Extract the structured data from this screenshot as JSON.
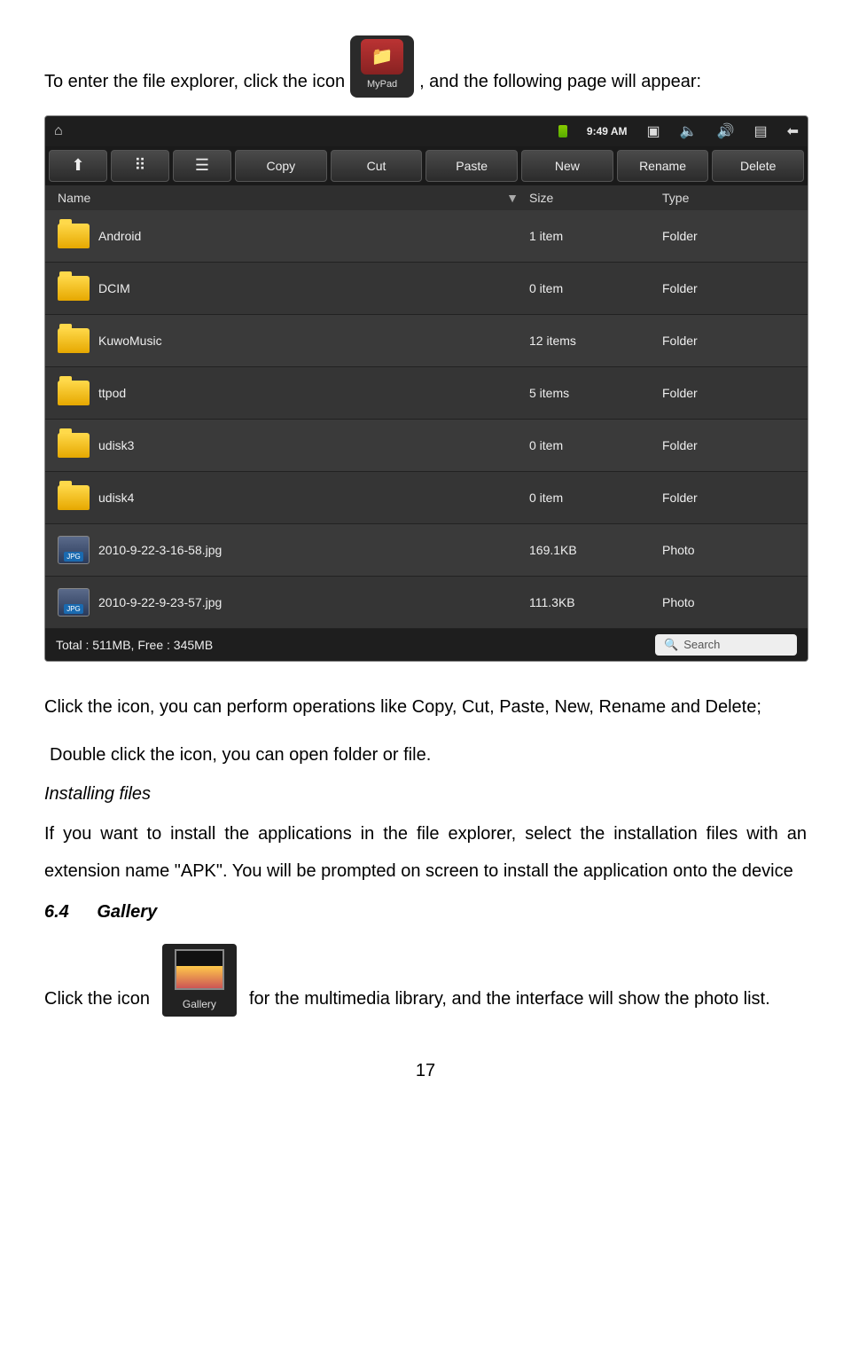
{
  "intro": {
    "before": "To enter the file explorer, click the icon",
    "after": ", and the following page will appear:",
    "mypad_label": "MyPad"
  },
  "statusbar": {
    "time": "9:49 AM"
  },
  "toolbar": {
    "copy": "Copy",
    "cut": "Cut",
    "paste": "Paste",
    "new": "New",
    "rename": "Rename",
    "delete": "Delete"
  },
  "columns": {
    "name": "Name",
    "size": "Size",
    "type": "Type"
  },
  "rows": [
    {
      "name": "Android",
      "size": "1 item",
      "type": "Folder",
      "icon": "folder"
    },
    {
      "name": "DCIM",
      "size": "0 item",
      "type": "Folder",
      "icon": "folder"
    },
    {
      "name": "KuwoMusic",
      "size": "12 items",
      "type": "Folder",
      "icon": "folder"
    },
    {
      "name": "ttpod",
      "size": "5 items",
      "type": "Folder",
      "icon": "folder"
    },
    {
      "name": "udisk3",
      "size": "0 item",
      "type": "Folder",
      "icon": "folder"
    },
    {
      "name": "udisk4",
      "size": "0 item",
      "type": "Folder",
      "icon": "folder"
    },
    {
      "name": "2010-9-22-3-16-58.jpg",
      "size": "169.1KB",
      "type": "Photo",
      "icon": "photo"
    },
    {
      "name": "2010-9-22-9-23-57.jpg",
      "size": "111.3KB",
      "type": "Photo",
      "icon": "photo"
    }
  ],
  "bottombar": {
    "total": "Total : 511MB, Free : 345MB",
    "search": "Search"
  },
  "body": {
    "p1": "Click the icon, you can perform operations like Copy, Cut, Paste, New, Rename and Delete;",
    "p2": "Double click the icon, you can open folder or file.",
    "h_install": "Installing files",
    "p3": "If you want to install the applications in the file explorer, select the installation files with an extension name \"APK\". You will be prompted on screen to install the application onto the device",
    "sec_num": "6.4",
    "sec_title": "Gallery",
    "gallery_before": "Click the icon",
    "gallery_label": "Gallery",
    "gallery_after": "for the multimedia library, and the interface will show the photo list.",
    "page": "17"
  }
}
